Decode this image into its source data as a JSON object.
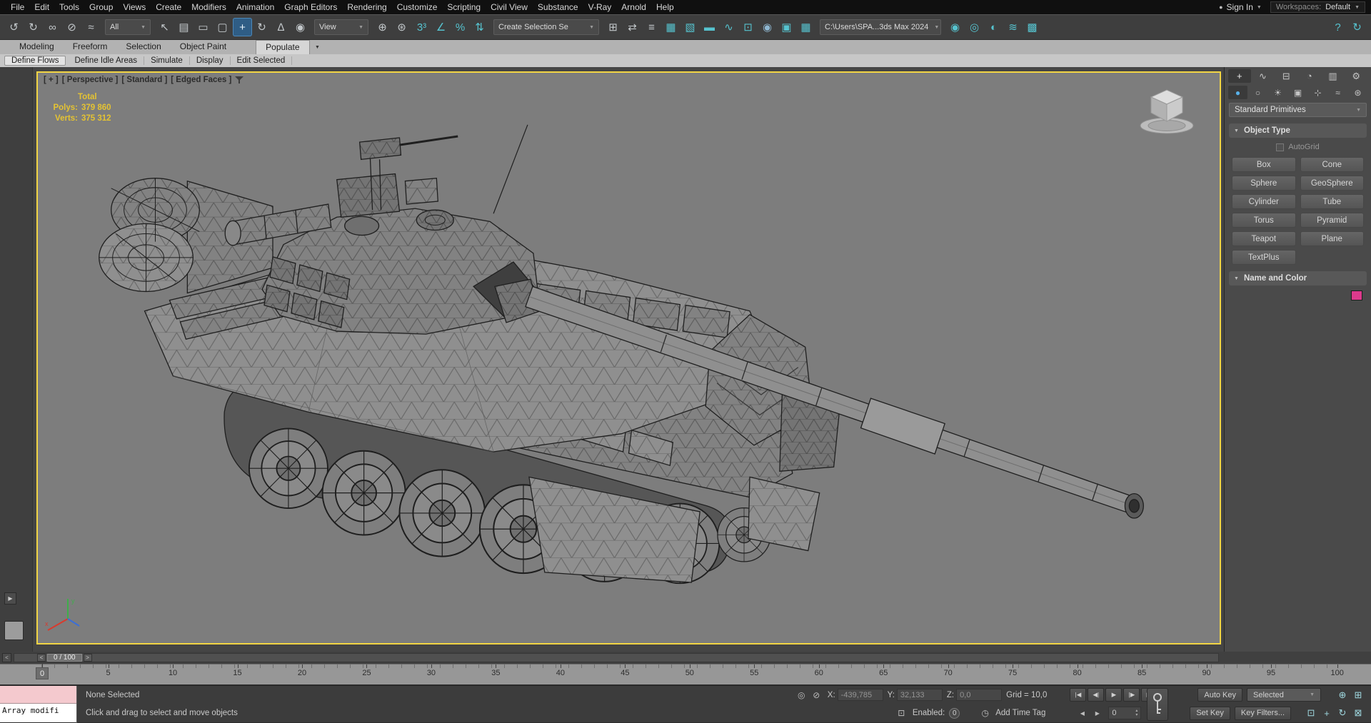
{
  "icons": {
    "caret": "▼",
    "spin_up": "▴",
    "spin_down": "▾",
    "clock": "◷",
    "enabled_box": "⊡",
    "prev_key": "◀",
    "next_key": "▶",
    "user": "●",
    "arrow_play": "▶",
    "roll_open": "▼"
  },
  "menubar": {
    "items": [
      "File",
      "Edit",
      "Tools",
      "Group",
      "Views",
      "Create",
      "Modifiers",
      "Animation",
      "Graph Editors",
      "Rendering",
      "Customize",
      "Scripting",
      "Civil View",
      "Substance",
      "V-Ray",
      "Arnold",
      "Help"
    ],
    "sign_in": "Sign In",
    "workspaces_label": "Workspaces:",
    "workspaces_value": "Default"
  },
  "toolbar": {
    "filter_value": "All",
    "view_value": "View",
    "selection_set_value": "Create Selection Se",
    "project_path": "C:\\Users\\SPA...3ds Max 2024",
    "icons_a": [
      {
        "name": "undo-icon",
        "glyph": "↺"
      },
      {
        "name": "redo-icon",
        "glyph": "↻"
      },
      {
        "name": "select-and-link-icon",
        "glyph": "∞"
      },
      {
        "name": "unlink-selection-icon",
        "glyph": "⊘"
      },
      {
        "name": "bind-to-space-warp-icon",
        "glyph": "≈"
      }
    ],
    "icons_b": [
      {
        "name": "select-object-icon",
        "glyph": "↖"
      },
      {
        "name": "select-by-name-icon",
        "glyph": "▤"
      },
      {
        "name": "rectangular-selection-region-icon",
        "glyph": "▭"
      },
      {
        "name": "window-crossing-toggle-icon",
        "glyph": "▢"
      }
    ],
    "icons_c": [
      {
        "name": "select-and-move-icon",
        "glyph": "+",
        "active": true
      },
      {
        "name": "select-and-rotate-icon",
        "glyph": "↻"
      },
      {
        "name": "select-and-uniform-scale-icon",
        "glyph": "∆"
      },
      {
        "name": "select-and-place-icon",
        "glyph": "◉"
      }
    ],
    "icons_d": [
      {
        "name": "use-pivot-point-center-icon",
        "glyph": "⊕"
      },
      {
        "name": "select-and-manipulate-icon",
        "glyph": "⊛"
      }
    ],
    "icons_e": [
      {
        "name": "snaps-toggle-icon",
        "glyph": "3³",
        "tint": "#56c3cf"
      },
      {
        "name": "angle-snap-toggle-icon",
        "glyph": "∠",
        "tint": "#56c3cf"
      },
      {
        "name": "percent-snap-toggle-icon",
        "glyph": "%",
        "tint": "#56c3cf"
      },
      {
        "name": "spinner-snap-toggle-icon",
        "glyph": "⇅",
        "tint": "#56c3cf"
      }
    ],
    "icons_f": [
      {
        "name": "edit-named-selection-sets-icon",
        "glyph": "⊞"
      },
      {
        "name": "mirror-icon",
        "glyph": "⇄"
      },
      {
        "name": "align-icon",
        "glyph": "≡"
      },
      {
        "name": "toggle-scene-explorer-icon",
        "glyph": "▦",
        "tint": "#56c3cf"
      },
      {
        "name": "toggle-layer-explorer-icon",
        "glyph": "▧",
        "tint": "#56c3cf"
      },
      {
        "name": "toggle-ribbon-icon",
        "glyph": "▬",
        "tint": "#56c3cf"
      },
      {
        "name": "curve-editor-icon",
        "glyph": "∿",
        "tint": "#56c3cf"
      },
      {
        "name": "schematic-view-icon",
        "glyph": "⊡",
        "tint": "#56c3cf"
      },
      {
        "name": "material-editor-icon",
        "glyph": "◉",
        "tint": "#8fb7d1"
      },
      {
        "name": "render-setup-icon",
        "glyph": "▣",
        "tint": "#56c3cf"
      },
      {
        "name": "rendered-frame-window-icon",
        "glyph": "▦",
        "tint": "#56c3cf"
      }
    ],
    "icons_g": [
      {
        "name": "render-production-icon",
        "glyph": "◉",
        "tint": "#56c3cf"
      },
      {
        "name": "render-iterative-icon",
        "glyph": "◎",
        "tint": "#56c3cf"
      },
      {
        "name": "activeshade-icon",
        "glyph": "◐",
        "tint": "#56c3cf"
      },
      {
        "name": "cloud-rendering-icon",
        "glyph": "≋",
        "tint": "#56c3cf"
      },
      {
        "name": "render-gallery-icon",
        "glyph": "▩",
        "tint": "#56c3cf"
      }
    ],
    "icons_h": [
      {
        "name": "help-icon",
        "glyph": "?",
        "tint": "#56c3cf"
      },
      {
        "name": "whats-new-icon",
        "glyph": "↻",
        "tint": "#56c3cf"
      }
    ]
  },
  "ribbon": {
    "tabs": [
      {
        "label": "Modeling"
      },
      {
        "label": "Freeform"
      },
      {
        "label": "Selection"
      },
      {
        "label": "Object Paint"
      },
      {
        "label": "Populate",
        "active": true
      }
    ],
    "subtabs": [
      "Define Flows",
      "Define Idle Areas",
      "Simulate",
      "Display",
      "Edit Selected"
    ]
  },
  "viewport": {
    "label_segments": [
      "[ + ]",
      "[ Perspective ]",
      "[ Standard ]",
      "[ Edged Faces ]"
    ],
    "stats_total_label": "Total",
    "stats_rows": [
      {
        "label": "Polys:",
        "value": "379 860"
      },
      {
        "label": "Verts:",
        "value": "375 312"
      }
    ],
    "axis_x": "x",
    "axis_y": "y"
  },
  "command_panel": {
    "tabs": [
      {
        "name": "create-tab-icon",
        "glyph": "+",
        "active": true
      },
      {
        "name": "modify-tab-icon",
        "glyph": "∿"
      },
      {
        "name": "hierarchy-tab-icon",
        "glyph": "⊟"
      },
      {
        "name": "motion-tab-icon",
        "glyph": "◔"
      },
      {
        "name": "display-tab-icon",
        "glyph": "▥"
      },
      {
        "name": "utilities-tab-icon",
        "glyph": "⚙"
      }
    ],
    "categories": [
      {
        "name": "geometry-category-icon",
        "glyph": "●",
        "active": true
      },
      {
        "name": "shapes-category-icon",
        "glyph": "○"
      },
      {
        "name": "lights-category-icon",
        "glyph": "☀"
      },
      {
        "name": "cameras-category-icon",
        "glyph": "▣"
      },
      {
        "name": "helpers-category-icon",
        "glyph": "⊹"
      },
      {
        "name": "space-warps-category-icon",
        "glyph": "≈"
      },
      {
        "name": "systems-category-icon",
        "glyph": "⊛"
      }
    ],
    "subcategory_value": "Standard Primitives",
    "object_type_label": "Object Type",
    "autogrid_label": "AutoGrid",
    "primitive_buttons": [
      "Box",
      "Cone",
      "Sphere",
      "GeoSphere",
      "Cylinder",
      "Tube",
      "Torus",
      "Pyramid",
      "Teapot",
      "Plane",
      "TextPlus"
    ],
    "name_color_label": "Name and Color",
    "swatch_color": "#dd3a8c"
  },
  "timeline": {
    "scroll_left": "<",
    "prev_frame": "<",
    "handle_label": "0 / 100",
    "next_frame": ">",
    "ticks": [
      "0",
      "5",
      "10",
      "15",
      "20",
      "25",
      "30",
      "35",
      "40",
      "45",
      "50",
      "55",
      "60",
      "65",
      "70",
      "75",
      "80",
      "85",
      "90",
      "95",
      "100"
    ]
  },
  "statusbar": {
    "maxscript_text": "Array modifi",
    "selection_status": "None Selected",
    "prompt": "Click and drag to select and move objects",
    "lock_icons": [
      {
        "name": "isolate-selection-toggle-icon",
        "glyph": "◎"
      },
      {
        "name": "selection-lock-toggle-icon",
        "glyph": "⊘"
      }
    ],
    "x_label": "X:",
    "x_value": "-439,785",
    "y_label": "Y:",
    "y_value": "32,133",
    "z_label": "Z:",
    "z_value": "0,0",
    "grid_text": "Grid = 10,0",
    "playback": [
      {
        "name": "go-to-start-button",
        "glyph": "|◀"
      },
      {
        "name": "previous-frame-button",
        "glyph": "◀|"
      },
      {
        "name": "play-animation-button",
        "glyph": "▶"
      },
      {
        "name": "next-frame-button",
        "glyph": "|▶"
      },
      {
        "name": "go-to-end-button",
        "glyph": "▶|"
      }
    ],
    "auto_key_label": "Auto Key",
    "selection_dropdown_value": "Selected",
    "set_key_label": "Set Key",
    "key_filters_label": "Key Filters...",
    "enabled_label": "Enabled:",
    "enabled_value": "0",
    "add_time_tag_label": "Add Time Tag",
    "frame_value": "0",
    "nav_icons_top": [
      {
        "name": "zoom-icon",
        "glyph": "⊕",
        "tint": "#9fd8e0"
      },
      {
        "name": "zoom-all-icon",
        "glyph": "⊞",
        "tint": "#9fd8e0"
      }
    ],
    "nav_icons_bottom": [
      {
        "name": "zoom-extents-icon",
        "glyph": "⊡",
        "tint": "#9fd8e0"
      },
      {
        "name": "pan-view-icon",
        "glyph": "+",
        "tint": "#9fd8e0"
      },
      {
        "name": "orbit-icon",
        "glyph": "↻",
        "tint": "#9fd8e0"
      },
      {
        "name": "maximize-viewport-toggle-icon",
        "glyph": "⊠",
        "tint": "#9fd8e0"
      }
    ]
  }
}
